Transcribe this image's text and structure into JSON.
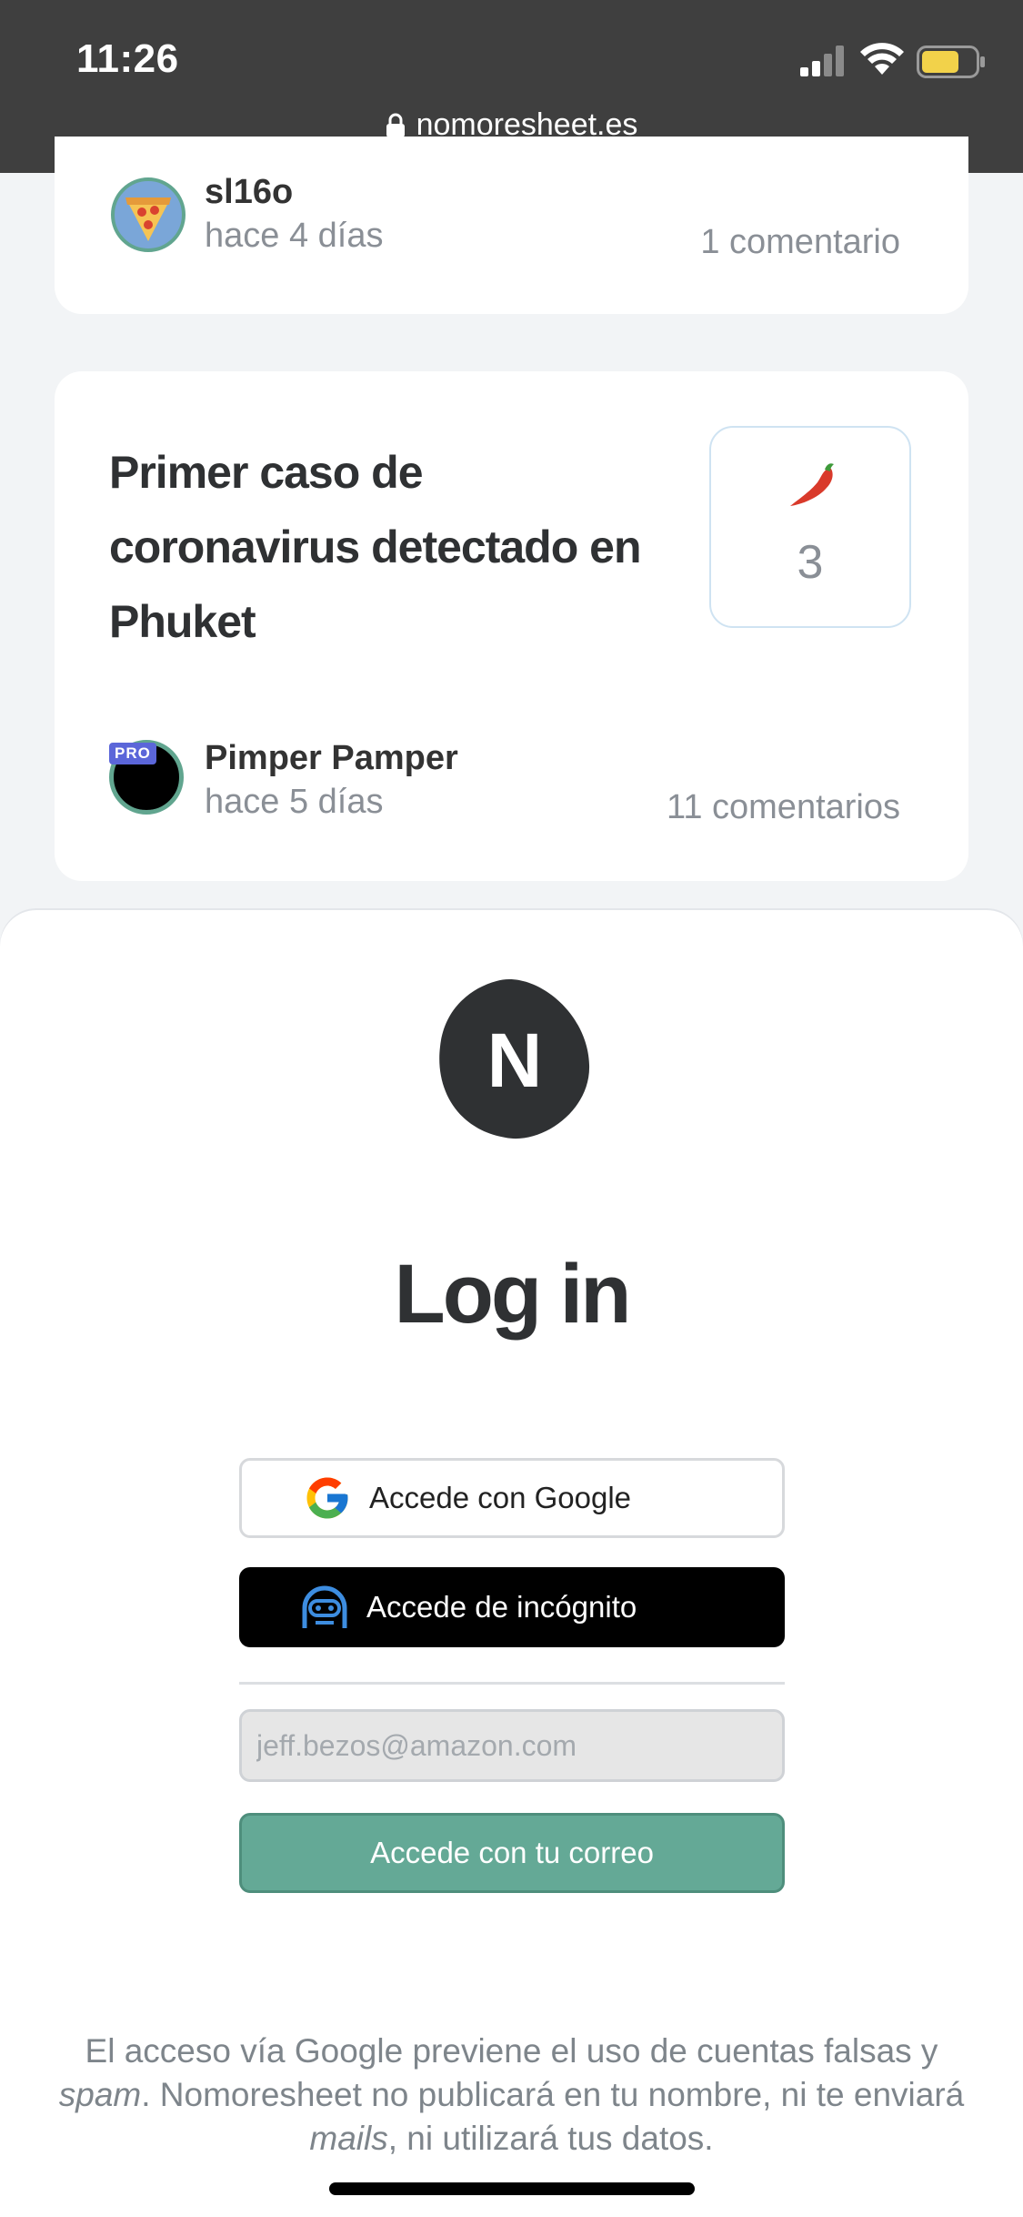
{
  "status_bar": {
    "time": "11:26",
    "url": "nomoresheet.es"
  },
  "feed": {
    "card1": {
      "author": "sl16o",
      "time_ago": "hace 4 días",
      "comments": "1 comentario"
    },
    "card2": {
      "title": "Primer caso de coronavirus detectado en Phuket",
      "votes": "3",
      "author": "Pimper Pamper",
      "badge": "PRO",
      "time_ago": "hace 5 días",
      "comments": "11 comentarios"
    }
  },
  "login": {
    "logo_letter": "N",
    "title": "Log in",
    "google_label": "Accede con Google",
    "incognito_label": "Accede de incógnito",
    "email_placeholder": "jeff.bezos@amazon.com",
    "email_button_label": "Accede con tu correo",
    "disclaimer_part1": "El acceso vía Google previene el uso de cuentas falsas y ",
    "disclaimer_spam": "spam",
    "disclaimer_part2": ". Nomoresheet no publicará en tu nombre, ni te enviará ",
    "disclaimer_mails": "mails",
    "disclaimer_part3": ", ni utilizará tus datos."
  },
  "colors": {
    "accent_green": "#64a996",
    "status_bar_bg": "#3f3f3f",
    "pro_badge": "#5b66d9"
  }
}
